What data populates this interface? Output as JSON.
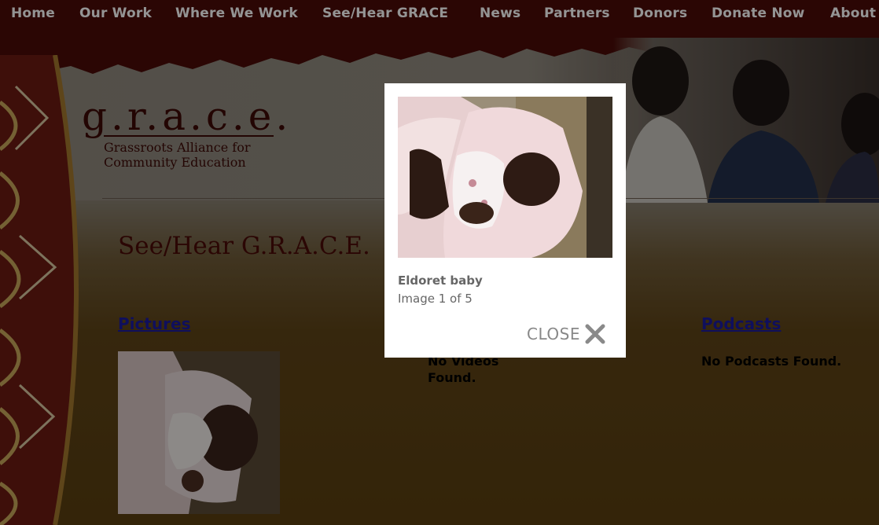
{
  "nav": {
    "items": [
      {
        "label": "Home"
      },
      {
        "label": "Our Work"
      },
      {
        "label": "Where We Work"
      },
      {
        "label": "See/Hear GRACE"
      },
      {
        "label": "News"
      },
      {
        "label": "Partners"
      },
      {
        "label": "Donors"
      },
      {
        "label": "Donate Now"
      },
      {
        "label": "About"
      }
    ]
  },
  "logo": {
    "wordmark": "g.r.a.c.e.",
    "line1": "Grassroots Alliance for",
    "line2": "Community Education"
  },
  "page": {
    "title": "See/Hear G.R.A.C.E."
  },
  "sections": {
    "pictures": {
      "label": "Pictures"
    },
    "videos": {
      "empty_line1": "No Videos",
      "empty_line2": "Found."
    },
    "podcasts": {
      "label": "Podcasts",
      "empty": "No Podcasts Found."
    }
  },
  "lightbox": {
    "caption": "Eldoret baby",
    "counter": "Image 1 of 5",
    "close_label": "CLOSE",
    "close_icon": "close-icon"
  },
  "colors": {
    "nav_bg": "#4a0c08",
    "title": "#4a0c08",
    "link": "#1a1aa0"
  }
}
